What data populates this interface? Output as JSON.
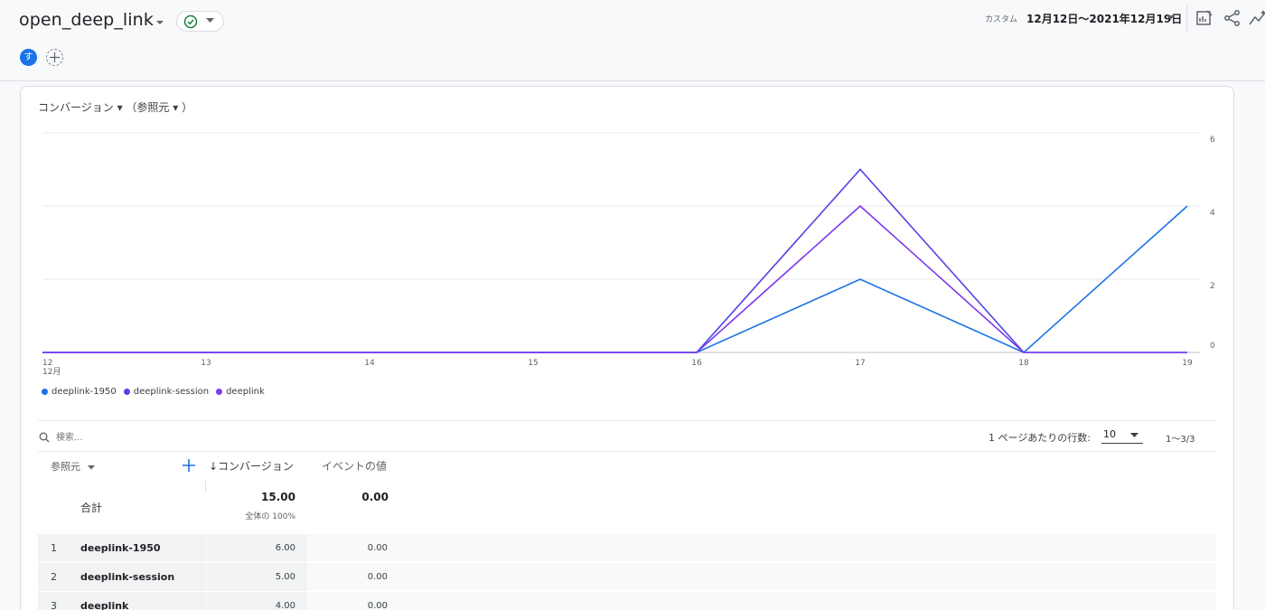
{
  "header": {
    "report_title": "open_deep_link",
    "avatar_letter": "す",
    "date_type": "カスタム",
    "date_range": "12月12日〜2021年12月19日"
  },
  "chart_card": {
    "metric_label": "コンバージョン ▾ （参照元 ▾ ）"
  },
  "chart_data": {
    "type": "line",
    "x": [
      "12",
      "13",
      "14",
      "15",
      "16",
      "17",
      "18",
      "19"
    ],
    "x_month_label": "12月",
    "ylim": [
      0,
      6
    ],
    "y_ticks": [
      0,
      2,
      4,
      6
    ],
    "y_axis_side": "right",
    "grid": true,
    "legend_position": "bottom-left",
    "series": [
      {
        "name": "deeplink-1950",
        "color": "#1a73e8",
        "values": [
          0,
          0,
          0,
          0,
          0,
          2,
          0,
          4
        ]
      },
      {
        "name": "deeplink-session",
        "color": "#4f46e5",
        "values": [
          0,
          0,
          0,
          0,
          0,
          5,
          0,
          0
        ]
      },
      {
        "name": "deeplink",
        "color": "#7c3aed",
        "values": [
          0,
          0,
          0,
          0,
          0,
          4,
          0,
          0
        ]
      }
    ]
  },
  "table": {
    "search_placeholder": "検索...",
    "rows_per_page_label": "1 ページあたりの行数:",
    "rows_per_page_value": "10",
    "pagination": "1〜3/3",
    "col_dimension": "参照元",
    "col_conversions": "↓コンバージョン",
    "col_event_value": "イベントの値",
    "total": {
      "label": "合計",
      "conversions": "15.00",
      "conversions_sub": "全体の 100%",
      "event_value": "0.00"
    },
    "rows": [
      {
        "index": "1",
        "name": "deeplink-1950",
        "conversions": "6.00",
        "event_value": "0.00"
      },
      {
        "index": "2",
        "name": "deeplink-session",
        "conversions": "5.00",
        "event_value": "0.00"
      },
      {
        "index": "3",
        "name": "deeplink",
        "conversions": "4.00",
        "event_value": "0.00"
      }
    ]
  },
  "colors": {
    "accent": "#1a73e8",
    "status_ok": "#188038"
  },
  "icons": [
    "caret-down-icon",
    "check-circle-icon",
    "plus-icon",
    "edit-chart-icon",
    "share-icon",
    "insights-icon",
    "search-icon"
  ]
}
